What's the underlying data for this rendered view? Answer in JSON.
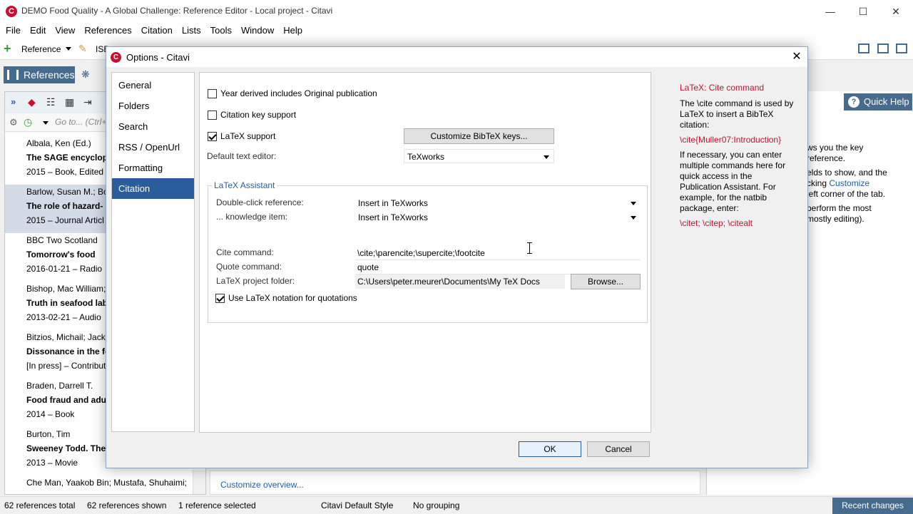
{
  "window": {
    "title": "DEMO Food Quality - A Global Challenge: Reference Editor - Local project - Citavi",
    "min": "—",
    "max": "☐",
    "close": "✕"
  },
  "menu": [
    "File",
    "Edit",
    "View",
    "References",
    "Citation",
    "Lists",
    "Tools",
    "Window",
    "Help"
  ],
  "toolbar": {
    "reference_label": "Reference",
    "isbn_fragment": "ISB"
  },
  "left": {
    "nav_button": "References",
    "goto_placeholder": "Go to... (Ctrl+",
    "references": [
      {
        "author": "Albala, Ken (Ed.)",
        "title": "The SAGE encyclope",
        "meta": "2015 – Book, Edited"
      },
      {
        "author": "Barlow, Susan M.; Bo",
        "title": "The role of hazard- a",
        "meta": "2015 – Journal Articl"
      },
      {
        "author": "BBC Two Scotland",
        "title": "Tomorrow's food",
        "meta": "2016-01-21 – Radio"
      },
      {
        "author": "Bishop, Mac William;",
        "title": "Truth in seafood lab",
        "meta": "2013-02-21 – Audio"
      },
      {
        "author": "Bitzios, Michail; Jack,",
        "title": "Dissonance in the fo",
        "meta": "[In press] – Contribut"
      },
      {
        "author": "Braden, Darrell T.",
        "title": "Food fraud and adult",
        "meta": "2014 – Book"
      },
      {
        "author": "Burton, Tim",
        "title": "Sweeney Todd. The",
        "meta": "2013 – Movie"
      },
      {
        "author": "Che Man, Yaakob Bin; Mustafa, Shuhaimi;",
        "title": "",
        "meta": ""
      }
    ]
  },
  "right": {
    "quick_help": "Quick Help",
    "lines": [
      {
        "text": "ws you the key"
      },
      {
        "text": "reference."
      },
      {
        "text": "elds to show, and the"
      },
      {
        "text": "cking ",
        "link": "Customize"
      },
      {
        "text": "left corner of the tab."
      },
      {
        "text": "perform the most"
      },
      {
        "text": "mostly editing)."
      }
    ]
  },
  "middle": {
    "customize_overview": "Customize overview..."
  },
  "status": {
    "total": "62 references total",
    "shown": "62 references shown",
    "selected": "1 reference selected",
    "style": "Citavi Default Style",
    "grouping": "No grouping",
    "recent": "Recent changes"
  },
  "dialog": {
    "title": "Options - Citavi",
    "nav": [
      "General",
      "Folders",
      "Search",
      "RSS / OpenUrl",
      "Formatting",
      "Citation"
    ],
    "selected_nav": "Citation",
    "year_derived": {
      "label": "Year derived includes Original publication",
      "checked": false
    },
    "citation_key": {
      "label": "Citation key support",
      "checked": false
    },
    "latex_support": {
      "label": "LaTeX support",
      "checked": true
    },
    "customize_bibtex": "Customize BibTeX keys...",
    "default_editor_label": "Default text editor:",
    "default_editor_value": "TeXworks",
    "latex_assistant": {
      "legend": "LaTeX Assistant",
      "double_click_label": "Double-click reference:",
      "double_click_value": "Insert in TeXworks",
      "knowledge_label": "... knowledge item:",
      "knowledge_value": "Insert in TeXworks",
      "cite_label": "Cite command:",
      "cite_value": "\\cite;\\parencite;\\supercite;\\footcite",
      "quote_label": "Quote command:",
      "quote_value": "quote",
      "folder_label": "LaTeX project folder:",
      "folder_value": "C:\\Users\\peter.meurer\\Documents\\My TeX Docs",
      "browse": "Browse...",
      "use_notation": {
        "label": "Use LaTeX notation for quotations",
        "checked": true
      }
    },
    "help": {
      "title": "LaTeX: Cite command",
      "p1": "The \\cite command is used by LaTeX to insert a BibTeX citation:",
      "example": "\\cite{Muller07:Introduction}",
      "p2": "If necessary, you can enter multiple commands here for quick access in the Publication Assistant. For example, for the natbib package, enter:",
      "example2": "\\citet; \\citep; \\citealt"
    },
    "ok": "OK",
    "cancel": "Cancel"
  },
  "colors": {
    "accent": "#476b8e",
    "selected_nav": "#2a5d9c",
    "help_red": "#c8102e"
  }
}
